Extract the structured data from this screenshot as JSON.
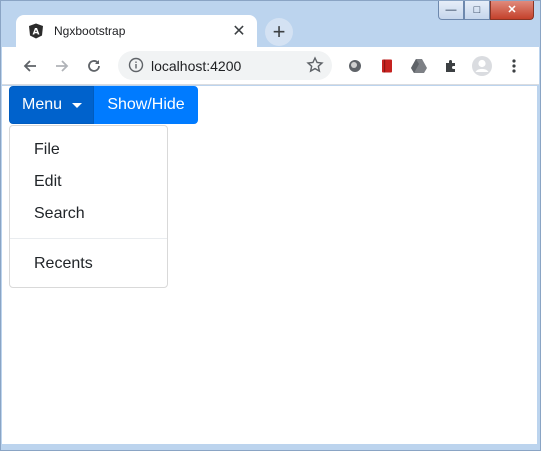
{
  "browser": {
    "tab_title": "Ngxbootstrap",
    "url": "localhost:4200"
  },
  "window_controls": {
    "minimize": "—",
    "maximize": "□",
    "close": "✕"
  },
  "page": {
    "menu_button": "Menu",
    "toggle_button": "Show/Hide",
    "dropdown_items": [
      "File",
      "Edit",
      "Search",
      "Recents"
    ]
  },
  "colors": {
    "menu_button": "#0062cc",
    "toggle_button": "#007bff",
    "titlebar": "#bcd4ee"
  },
  "icons": {
    "favicon": "angular-icon",
    "extensions": [
      "circle-extension-icon",
      "red-book-icon",
      "google-drive-icon",
      "puzzle-icon",
      "profile-avatar-icon",
      "kebab-menu-icon"
    ]
  }
}
